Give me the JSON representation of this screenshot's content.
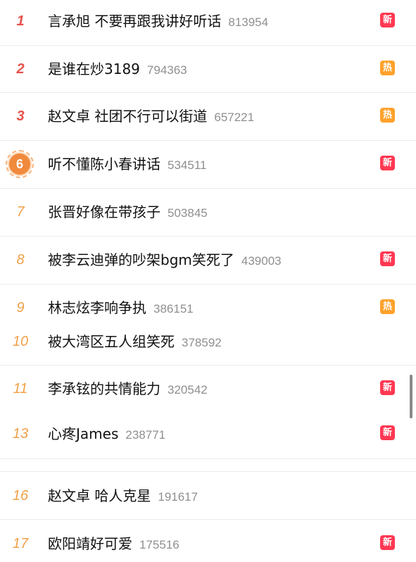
{
  "hot_list": [
    {
      "rank": "1",
      "title": "言承旭 不要再跟我讲好听话",
      "count": "813954",
      "badge": "新"
    },
    {
      "rank": "2",
      "title": "是谁在炒3189",
      "count": "794363",
      "badge": "热"
    },
    {
      "rank": "3",
      "title": "赵文卓 社团不行可以街道",
      "count": "657221",
      "badge": "热"
    },
    {
      "rank": "6",
      "title": "听不懂陈小春讲话",
      "count": "534511",
      "badge": "新"
    },
    {
      "rank": "7",
      "title": "张晋好像在带孩子",
      "count": "503845",
      "badge": ""
    },
    {
      "rank": "8",
      "title": "被李云迪弹的吵架bgm笑死了",
      "count": "439003",
      "badge": "新"
    },
    {
      "rank": "9",
      "title": "林志炫李响争执",
      "count": "386151",
      "badge": "热"
    },
    {
      "rank": "10",
      "title": "被大湾区五人组笑死",
      "count": "378592",
      "badge": ""
    },
    {
      "rank": "11",
      "title": "李承铉的共情能力",
      "count": "320542",
      "badge": "新"
    },
    {
      "rank": "13",
      "title": "心疼James",
      "count": "238771",
      "badge": "新"
    },
    {
      "rank": "16",
      "title": "赵文卓 哈人克星",
      "count": "191617",
      "badge": ""
    },
    {
      "rank": "17",
      "title": "欧阳靖好可爱",
      "count": "175516",
      "badge": "新"
    }
  ],
  "colors": {
    "rank_top": "#e5524b",
    "rank_mid": "#f0a047",
    "badge_new": "#ff3852",
    "badge_hot": "#ffa12b",
    "count_gray": "#8f8f8f"
  }
}
